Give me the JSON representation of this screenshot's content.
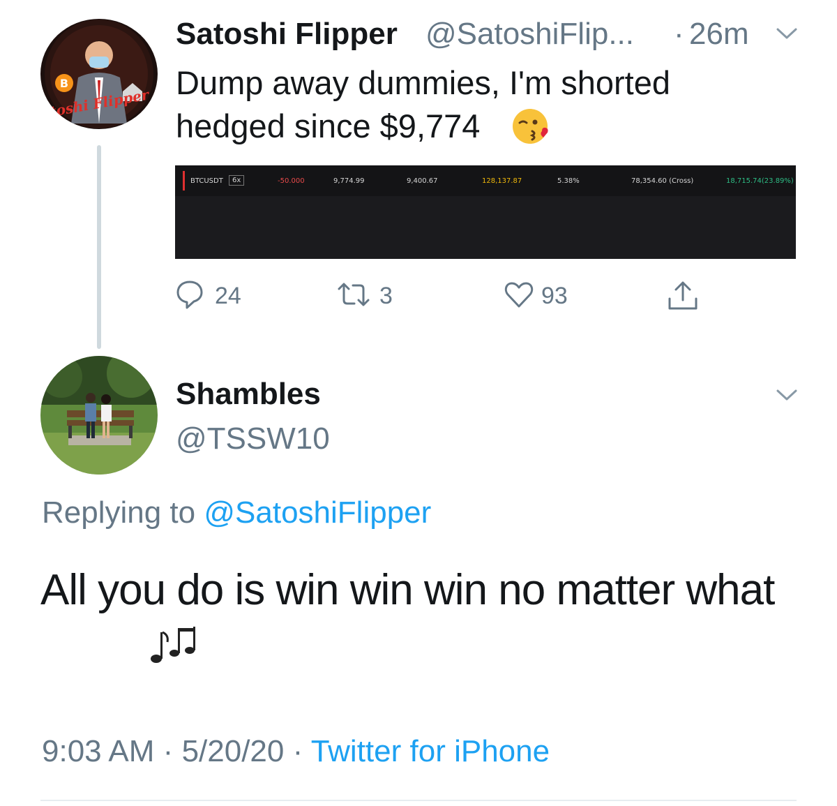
{
  "parent_tweet": {
    "avatar_text": "Satoshi Flipper",
    "display_name": "Satoshi Flipper",
    "handle": "@SatoshiFlip...",
    "separator": "·",
    "time": "26m",
    "text": "Dump away dummies, I'm shorted hedged since $9,774",
    "emoji": "face-blowing-a-kiss-emoji",
    "position_panel": {
      "symbol": "BTCUSDT",
      "leverage": "6x",
      "size": "-50.000",
      "entry_price": "9,774.99",
      "mark_price": "9,400.67",
      "liq_price": "128,137.87",
      "margin_ratio": "5.38%",
      "margin": "78,354.60 (Cross)",
      "pnl": "18,715.74(23.89%)",
      "colors": {
        "size": "#e84a4a",
        "liq_price": "#f0b90b",
        "pnl": "#2ebd85",
        "accent": "#e03030"
      }
    },
    "actions": {
      "replies": "24",
      "retweets": "3",
      "likes": "93"
    }
  },
  "reply_tweet": {
    "display_name": "Shambles",
    "handle": "@TSSW10",
    "replying_to_label": "Replying to",
    "replying_to_handle": "@SatoshiFlipper",
    "text": "All you do is win win win no matter what",
    "emoji": "musical-notes-emoji",
    "time": "9:03 AM",
    "date": "5/20/20",
    "source": "Twitter for iPhone",
    "meta_separator": "·"
  },
  "colors": {
    "link": "#1da1f2",
    "secondary_text": "#657786",
    "primary_text": "#14171a"
  }
}
